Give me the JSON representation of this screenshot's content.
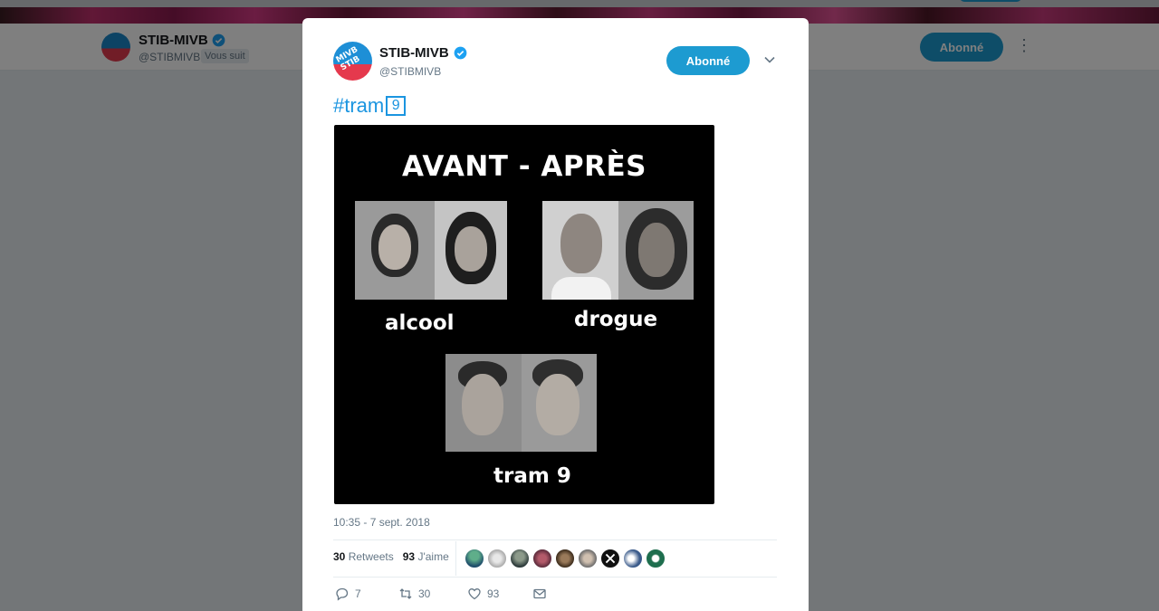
{
  "background": {
    "profile_name": "STIB-MIVB",
    "profile_handle": "@STIBMIVB",
    "follows_you": "Vous suit",
    "follow_label": "Abonné"
  },
  "tweet": {
    "display_name": "STIB-MIVB",
    "handle": "@STIBMIVB",
    "follow_label": "Abonné",
    "hashtag": "#tram",
    "keycap": "9",
    "media": {
      "title": "AVANT - APRÈS",
      "captions": [
        "alcool",
        "drogue",
        "tram 9"
      ]
    },
    "timestamp": "10:35 - 7 sept. 2018",
    "stats": {
      "retweets_count": "30",
      "retweets_label": "Retweets",
      "likes_count": "93",
      "likes_label": "J'aime"
    },
    "actions": {
      "reply_count": "7",
      "retweet_count": "30",
      "like_count": "93"
    }
  },
  "colors": {
    "accent": "#1d9bd1",
    "link": "#1b95e0",
    "muted": "#657786"
  }
}
